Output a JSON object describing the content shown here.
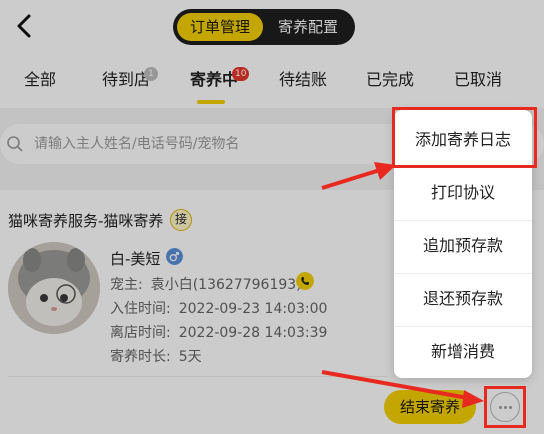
{
  "header": {
    "back_icon": "chevron-left-icon",
    "segments": [
      "订单管理",
      "寄养配置"
    ],
    "active_segment": 0
  },
  "tabs": [
    {
      "label": "全部",
      "badge": ""
    },
    {
      "label": "待到店",
      "badge": "1"
    },
    {
      "label": "寄养中",
      "badge": "10",
      "active": true
    },
    {
      "label": "待结账",
      "badge": ""
    },
    {
      "label": "已完成",
      "badge": ""
    },
    {
      "label": "已取消",
      "badge": ""
    }
  ],
  "search": {
    "icon": "search-icon",
    "placeholder": "请输入主人姓名/电话号码/宠物名"
  },
  "order": {
    "title": "猫咪寄养服务-猫咪寄养",
    "tag": "接",
    "pet_name": "白-美短",
    "gender_icon": "male-icon",
    "owner_label": "宠主:",
    "owner_value": "袁小白(13627796193)",
    "checkin_label": "入住时间:",
    "checkin_value": "2022-09-23 14:03:00",
    "checkout_label": "离店时间:",
    "checkout_value": "2022-09-28 14:03:39",
    "duration_label": "寄养时长:",
    "duration_value": "5天",
    "end_button": "结束寄养",
    "more_icon": "more-horizontal-icon"
  },
  "menu": {
    "items": [
      "添加寄养日志",
      "打印协议",
      "追加预存款",
      "退还预存款",
      "新增消费"
    ]
  },
  "colors": {
    "accent": "#f5d000",
    "badge_red": "#e8372c",
    "highlight_red": "#e8291f"
  }
}
